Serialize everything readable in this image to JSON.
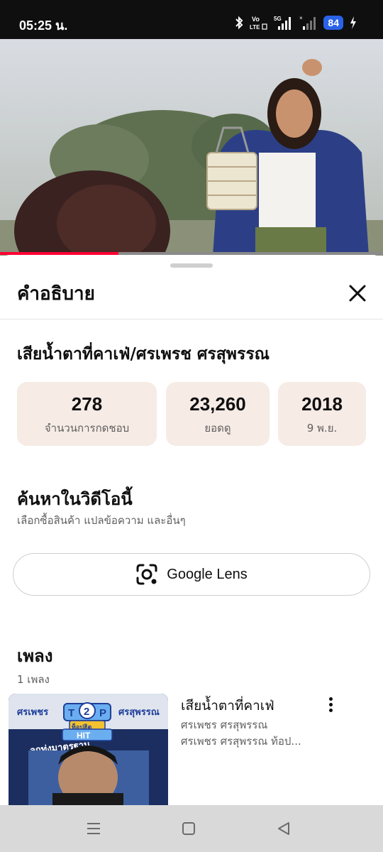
{
  "status_bar": {
    "time": "05:25 น.",
    "network_label": "Vo LTE",
    "network_type": "5G",
    "battery": "84",
    "icons": [
      "bluetooth-icon",
      "volte-icon",
      "signal-5g-icon",
      "signal-icon",
      "battery-icon",
      "charging-icon"
    ]
  },
  "video": {
    "progress_fraction": 0.31
  },
  "description_panel": {
    "title": "คำอธิบาย",
    "video_title": "เสียน้ำตาที่คาเฟ่/ศรเพรช  ศรสุพรรณ",
    "stats": [
      {
        "value": "278",
        "label": "จำนวนการกดชอบ"
      },
      {
        "value": "23,260",
        "label": "ยอดดู"
      },
      {
        "value": "2018",
        "label": "9 พ.ย."
      }
    ],
    "search_section": {
      "title": "ค้นหาในวิดีโอนี้",
      "subtitle": "เลือกซื้อสินค้า แปลข้อความ และอื่นๆ",
      "lens_button_label": "Google Lens"
    },
    "music_section": {
      "title": "เพลง",
      "count": "1 เพลง",
      "song": {
        "title": "เสียน้ำตาที่คาเฟ่",
        "artist": "ศรเพชร ศรสุพรรณ",
        "album": "ศรเพชร ศรสุพรรณ ท้อป...",
        "cover_text": {
          "left_name": "ศรเพชร",
          "right_name": "ศรสุพรรณ",
          "badge_t": "T",
          "badge_num": "2",
          "badge_p": "P",
          "badge_small": "ท็อปฮิต",
          "badge_hit": "HIT",
          "arc_text": "ลูกทุ่งมาตรฐาน"
        }
      }
    }
  },
  "colors": {
    "stat_background": "#f6ebe5",
    "progress_red": "#ff0033",
    "battery_blue": "#2a63e8",
    "album_navy": "#1c2e60"
  }
}
